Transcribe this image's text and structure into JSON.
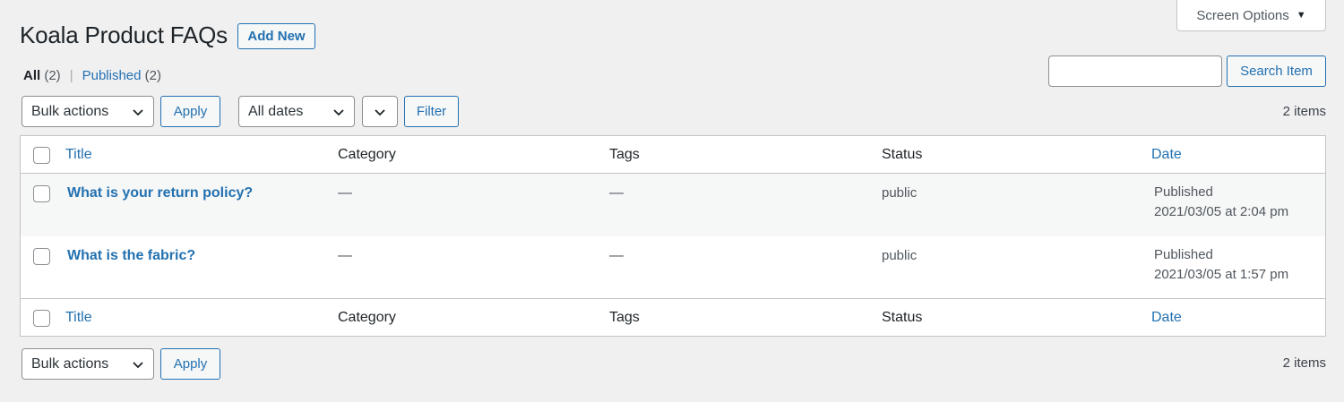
{
  "screen_options": {
    "label": "Screen Options"
  },
  "header": {
    "title": "Koala Product FAQs",
    "add_new": "Add New"
  },
  "views": {
    "all_label": "All",
    "all_count": "(2)",
    "published_label": "Published",
    "published_count": "(2)"
  },
  "search": {
    "value": "",
    "button": "Search Item"
  },
  "top_nav": {
    "bulk_actions": "Bulk actions",
    "apply": "Apply",
    "dates": "All dates",
    "filter": "Filter",
    "items": "2 items"
  },
  "table": {
    "columns": {
      "title": "Title",
      "category": "Category",
      "tags": "Tags",
      "status": "Status",
      "date": "Date"
    },
    "rows": [
      {
        "title": "What is your return policy?",
        "category": "—",
        "tags": "—",
        "status": "public",
        "date_status": "Published",
        "date": "2021/03/05 at 2:04 pm"
      },
      {
        "title": "What is the fabric?",
        "category": "—",
        "tags": "—",
        "status": "public",
        "date_status": "Published",
        "date": "2021/03/05 at 1:57 pm"
      }
    ]
  },
  "bottom_nav": {
    "bulk_actions": "Bulk actions",
    "apply": "Apply",
    "items": "2 items"
  }
}
